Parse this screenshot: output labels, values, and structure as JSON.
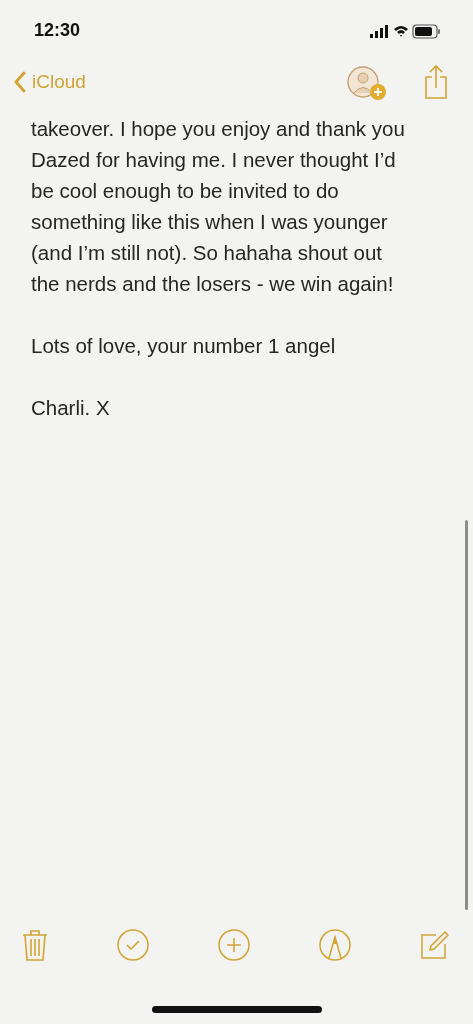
{
  "status_bar": {
    "time": "12:30"
  },
  "nav": {
    "back_label": "iCloud"
  },
  "note": {
    "paragraphs": [
      {
        "lines": [
          "takeover. I hope you enjoy and thank you",
          "Dazed for having me. I never thought I’d",
          "be cool enough to be invited to do",
          "something like this when I was younger",
          "(and I’m still not). So hahaha shout out",
          "the nerds and the losers - we win again!"
        ]
      },
      {
        "lines": [
          "Lots of love, your number 1 angel"
        ]
      },
      {
        "lines": [
          "Charli. X"
        ]
      }
    ]
  }
}
